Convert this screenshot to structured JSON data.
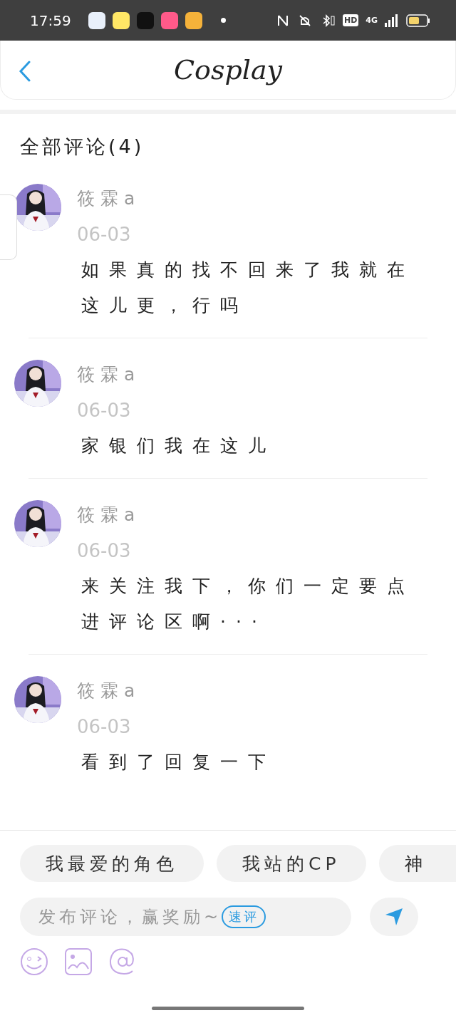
{
  "status_bar": {
    "time": "17:59",
    "network": "4G",
    "hd": "HD"
  },
  "header": {
    "title": "Cosplay"
  },
  "comments_section": {
    "title": "全部评论(4)"
  },
  "comments": [
    {
      "user": "筱霖a",
      "date": "06-03",
      "text": "如果真的找不回来了我就在这儿更，行吗"
    },
    {
      "user": "筱霖a",
      "date": "06-03",
      "text": "家银们我在这儿"
    },
    {
      "user": "筱霖a",
      "date": "06-03",
      "text": "来关注我下，你们一定要点进评论区啊···"
    },
    {
      "user": "筱霖a",
      "date": "06-03",
      "text": "看到了回复一下"
    }
  ],
  "quick_chips": [
    "我最爱的角色",
    "我站的CP",
    "神"
  ],
  "composer": {
    "placeholder": "发布评论，赢奖励~",
    "quick_badge": "速评"
  }
}
